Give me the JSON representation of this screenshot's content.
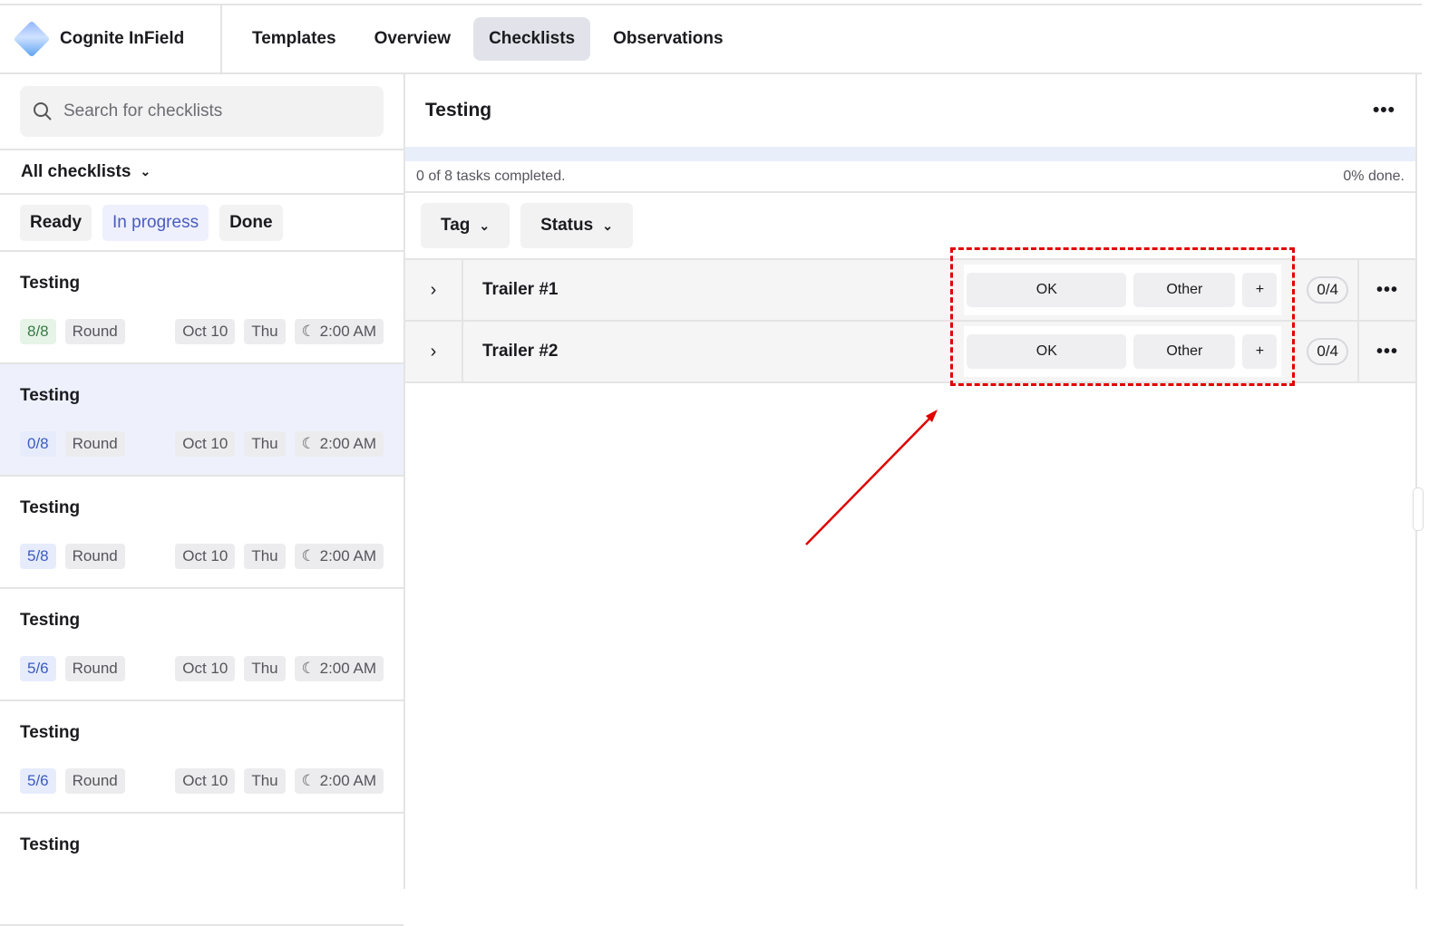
{
  "app": {
    "name": "Cognite InField"
  },
  "nav": [
    "Templates",
    "Overview",
    "Checklists",
    "Observations"
  ],
  "sidebar": {
    "search_placeholder": "Search for checklists",
    "filter": "All checklists",
    "status_filters": [
      "Ready",
      "In progress",
      "Done"
    ],
    "items": [
      {
        "title": "Testing",
        "progress": "8/8",
        "type": "Round",
        "date": "Oct 10",
        "day": "Thu",
        "time": "2:00 AM"
      },
      {
        "title": "Testing",
        "progress": "0/8",
        "type": "Round",
        "date": "Oct 10",
        "day": "Thu",
        "time": "2:00 AM"
      },
      {
        "title": "Testing",
        "progress": "5/8",
        "type": "Round",
        "date": "Oct 10",
        "day": "Thu",
        "time": "2:00 AM"
      },
      {
        "title": "Testing",
        "progress": "5/6",
        "type": "Round",
        "date": "Oct 10",
        "day": "Thu",
        "time": "2:00 AM"
      },
      {
        "title": "Testing",
        "progress": "5/6",
        "type": "Round",
        "date": "Oct 10",
        "day": "Thu",
        "time": "2:00 AM"
      },
      {
        "title": "Testing"
      }
    ]
  },
  "main": {
    "title": "Testing",
    "tasks_completed": "0 of 8 tasks completed.",
    "percent_done": "0% done.",
    "filters": [
      "Tag",
      "Status"
    ],
    "rows": [
      {
        "name": "Trailer #1",
        "ok": "OK",
        "other": "Other",
        "add": "+",
        "count": "0/4"
      },
      {
        "name": "Trailer #2",
        "ok": "OK",
        "other": "Other",
        "add": "+",
        "count": "0/4"
      }
    ]
  }
}
